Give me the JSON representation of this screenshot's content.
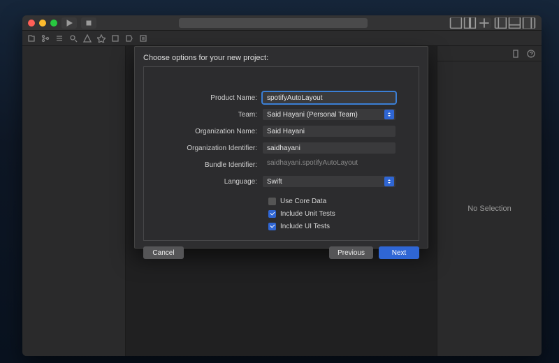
{
  "sheet": {
    "title": "Choose options for your new project:",
    "fields": {
      "product_name": {
        "label": "Product Name:",
        "value": "spotifyAutoLayout"
      },
      "team": {
        "label": "Team:",
        "value": "Said Hayani (Personal Team)"
      },
      "org_name": {
        "label": "Organization Name:",
        "value": "Said Hayani"
      },
      "org_id": {
        "label": "Organization Identifier:",
        "value": "saidhayani"
      },
      "bundle_id": {
        "label": "Bundle Identifier:",
        "value": "saidhayani.spotifyAutoLayout"
      },
      "language": {
        "label": "Language:",
        "value": "Swift"
      }
    },
    "checks": {
      "core_data": {
        "label": "Use Core Data",
        "checked": false
      },
      "unit_tests": {
        "label": "Include Unit Tests",
        "checked": true
      },
      "ui_tests": {
        "label": "Include UI Tests",
        "checked": true
      }
    },
    "buttons": {
      "cancel": "Cancel",
      "previous": "Previous",
      "next": "Next"
    }
  },
  "inspector": {
    "empty": "No Selection"
  }
}
